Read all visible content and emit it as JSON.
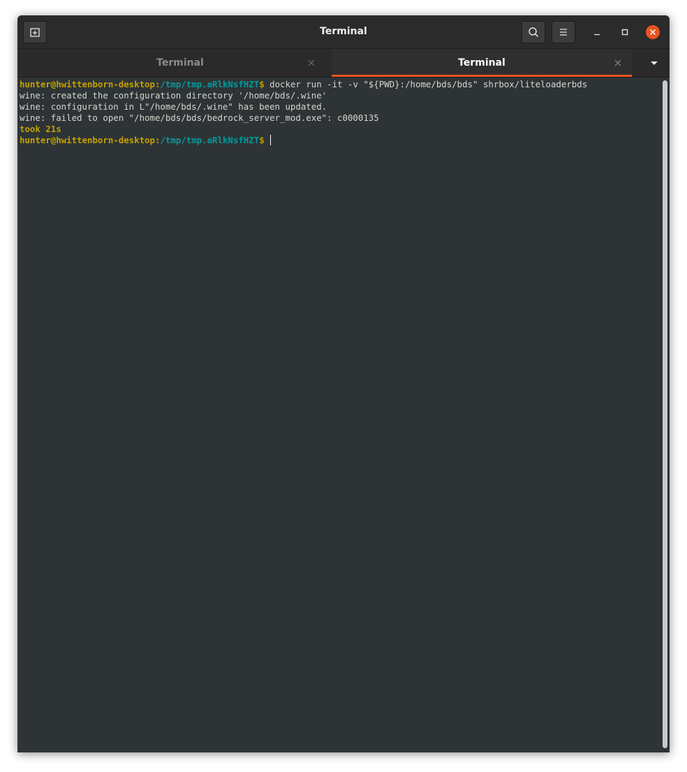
{
  "window": {
    "title": "Terminal"
  },
  "tabs": [
    {
      "label": "Terminal",
      "active": false
    },
    {
      "label": "Terminal",
      "active": true
    }
  ],
  "terminal": {
    "prompt1": {
      "user_host": "hunter@hwittenborn-desktop",
      "colon": ":",
      "path": "/tmp/tmp.aRlkNsfHZT",
      "symbol": "$",
      "command": " docker run -it -v \"${PWD}:/home/bds/bds\" shrbox/liteloaderbds"
    },
    "output": [
      "wine: created the configuration directory '/home/bds/.wine'",
      "wine: configuration in L\"/home/bds/.wine\" has been updated.",
      "wine: failed to open \"/home/bds/bds/bedrock_server_mod.exe\": c0000135"
    ],
    "took": "took 21s",
    "prompt2": {
      "user_host": "hunter@hwittenborn-desktop",
      "colon": ":",
      "path": "/tmp/tmp.aRlkNsfHZT",
      "symbol": "$",
      "command": " "
    }
  },
  "colors": {
    "accent": "#e95420",
    "prompt_user": "#c4a000",
    "prompt_path": "#06989a",
    "terminal_bg": "#2e3436"
  },
  "icons": {
    "new_tab": "new-tab-icon",
    "search": "search-icon",
    "menu": "hamburger-menu-icon",
    "minimize": "minimize-icon",
    "maximize": "maximize-icon",
    "close": "close-icon"
  }
}
